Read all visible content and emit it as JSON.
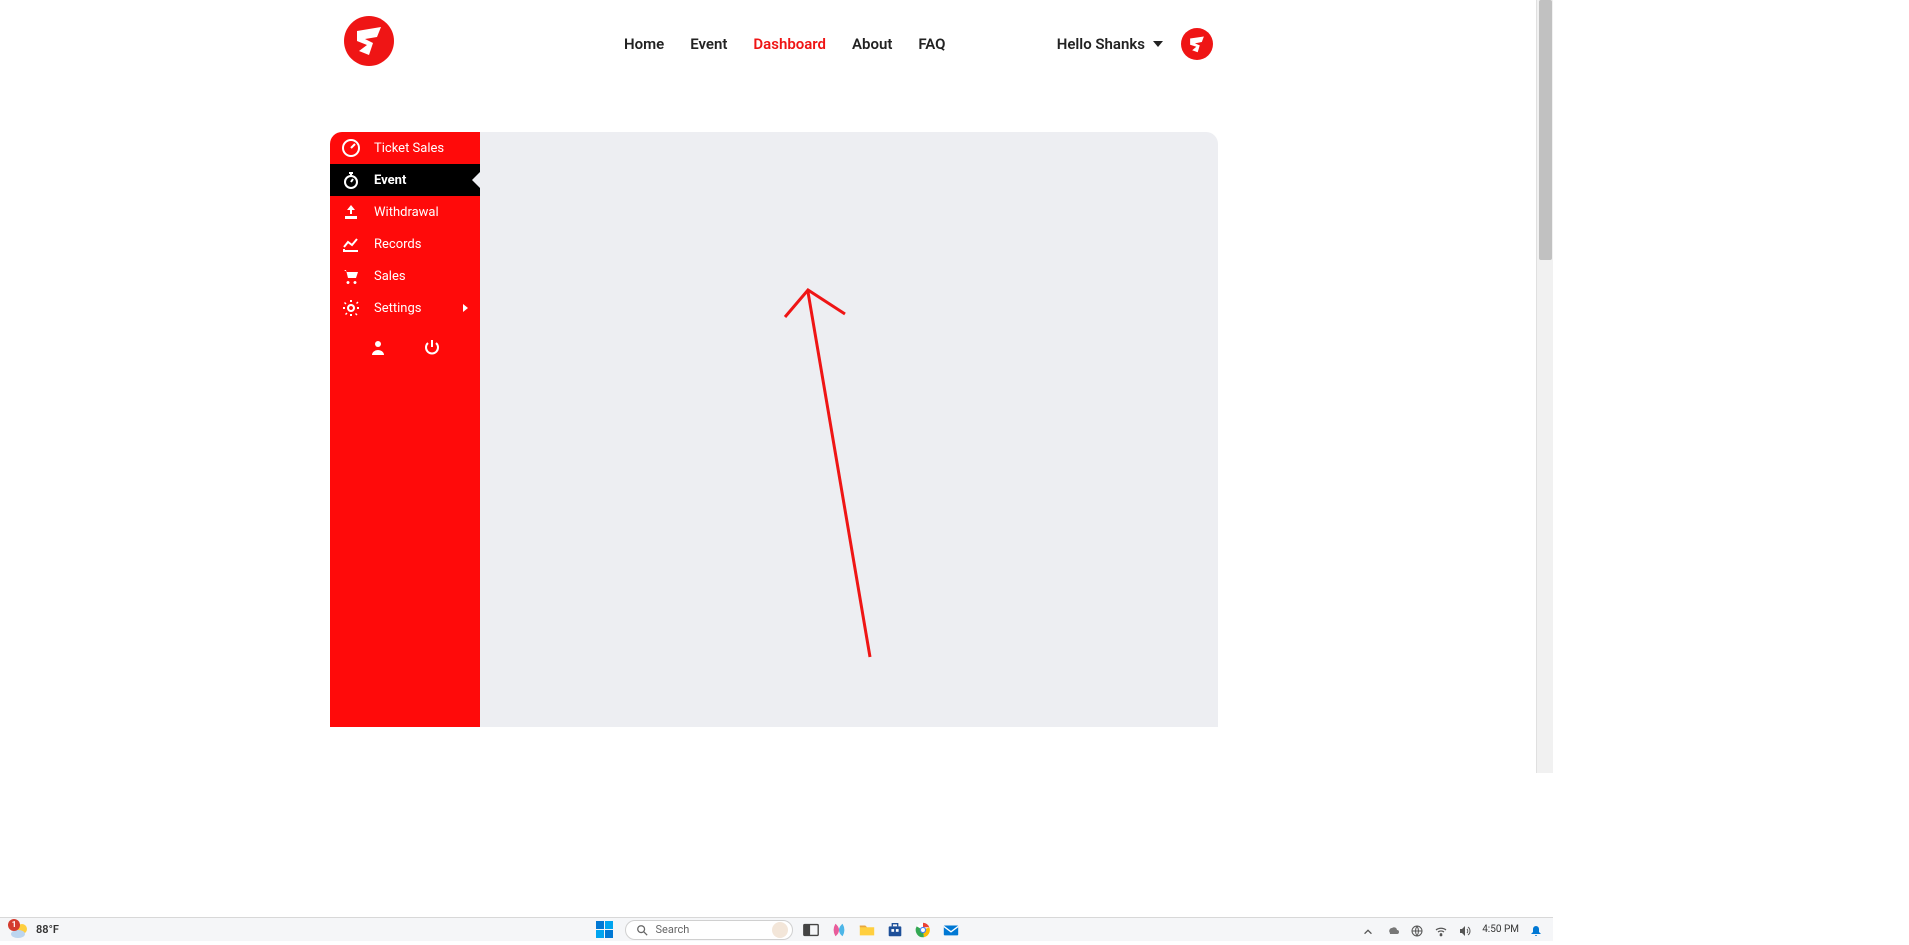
{
  "header": {
    "nav": [
      {
        "label": "Home",
        "active": false
      },
      {
        "label": "Event",
        "active": false
      },
      {
        "label": "Dashboard",
        "active": true
      },
      {
        "label": "About",
        "active": false
      },
      {
        "label": "FAQ",
        "active": false
      }
    ],
    "greeting": "Hello Shanks"
  },
  "sidebar": {
    "items": [
      {
        "label": "Ticket Sales",
        "icon": "gauge",
        "active": false
      },
      {
        "label": "Event",
        "icon": "stopwatch",
        "active": true
      },
      {
        "label": "Withdrawal",
        "icon": "upload",
        "active": false
      },
      {
        "label": "Records",
        "icon": "chart-line",
        "active": false
      },
      {
        "label": "Sales",
        "icon": "cart",
        "active": false
      },
      {
        "label": "Settings",
        "icon": "gear",
        "active": false,
        "expandable": true
      }
    ]
  },
  "taskbar": {
    "weather_badge": "1",
    "weather_temp": "88°F",
    "search_placeholder": "Search",
    "time": "4:50 PM"
  }
}
